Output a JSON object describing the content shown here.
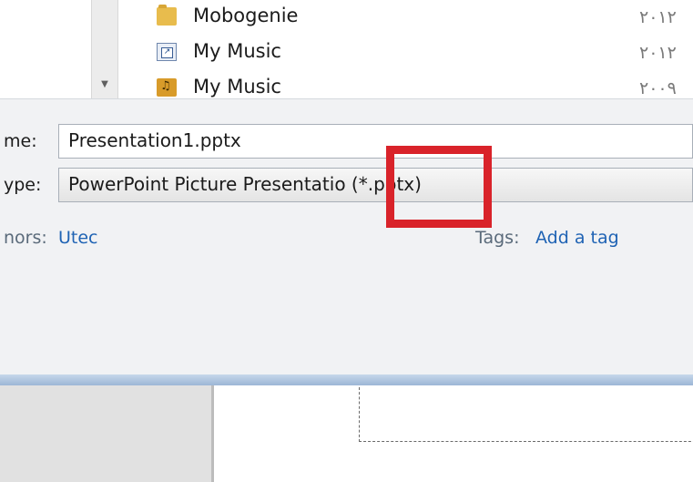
{
  "files": [
    {
      "name": "Mobogenie",
      "date": "٢٠١٢",
      "icon": "folder-icon"
    },
    {
      "name": "My Music",
      "date": "٢٠١٢",
      "icon": "shortcut-icon"
    },
    {
      "name": "My Music",
      "date": "٢٠٠٩",
      "icon": "music-folder-icon"
    }
  ],
  "form": {
    "filename_label": "me:",
    "filename_value": "Presentation1.pptx",
    "savetype_label": "ype:",
    "savetype_value": "PowerPoint Picture Presentatio  (*.pptx)",
    "authors_label": "nors:",
    "authors_value": "Utec",
    "tags_label": "Tags:",
    "tags_value": "Add a tag"
  },
  "colors": {
    "highlight": "#d9232a",
    "link": "#1f63b4"
  }
}
